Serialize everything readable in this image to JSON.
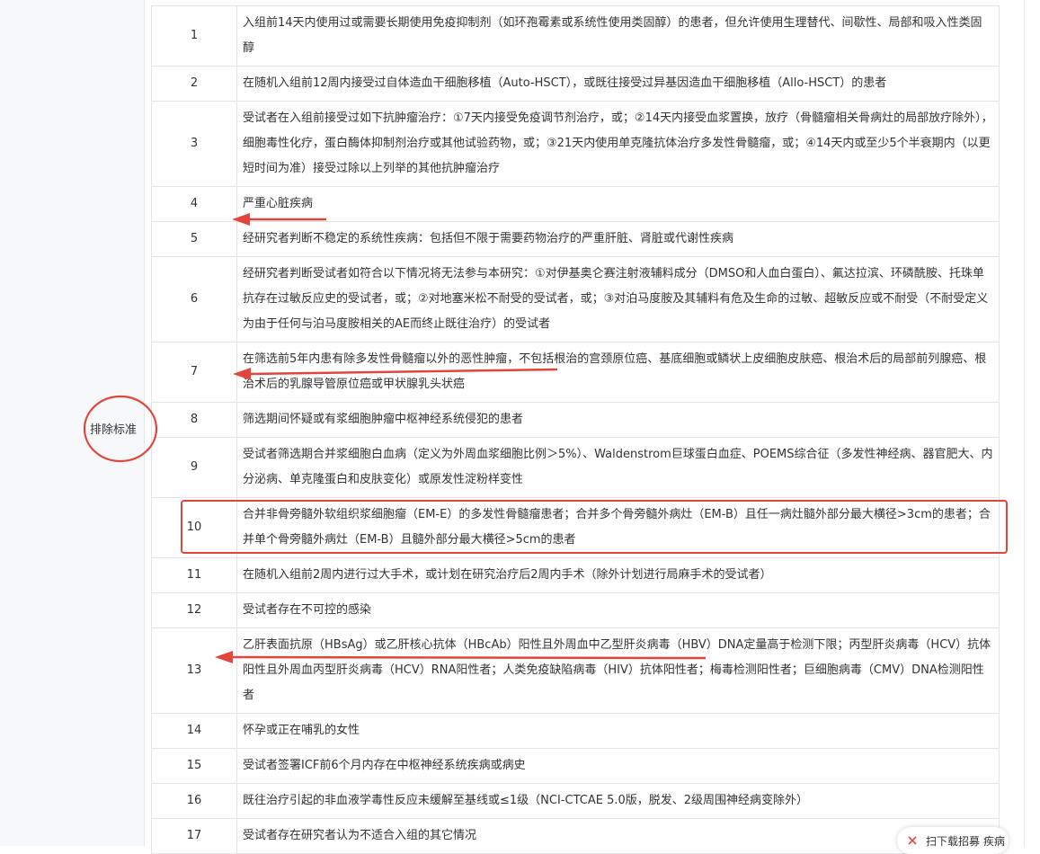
{
  "section_label": "排除标准",
  "annotation_color": "#e2453c",
  "rows": [
    {
      "num": "1",
      "text": "入组前14天内使用过或需要长期使用免疫抑制剂（如环孢霉素或系统性使用类固醇）的患者，但允许使用生理替代、间歇性、局部和吸入性类固醇"
    },
    {
      "num": "2",
      "text": "在随机入组前12周内接受过自体造血干细胞移植（Auto-HSCT），或既往接受过异基因造血干细胞移植（Allo-HSCT）的患者"
    },
    {
      "num": "3",
      "text": "受试者在入组前接受过如下抗肿瘤治疗：①7天内接受免疫调节剂治疗，或；②14天内接受血浆置换，放疗（骨髓瘤相关骨病灶的局部放疗除外），细胞毒性化疗，蛋白酶体抑制剂治疗或其他试验药物，或；③21天内使用单克隆抗体治疗多发性骨髓瘤，或；④14天内或至少5个半衰期内（以更短时间为准）接受过除以上列举的其他抗肿瘤治疗"
    },
    {
      "num": "4",
      "text": "严重心脏疾病"
    },
    {
      "num": "5",
      "text": "经研究者判断不稳定的系统性疾病：包括但不限于需要药物治疗的严重肝脏、肾脏或代谢性疾病"
    },
    {
      "num": "6",
      "text": "经研究者判断受试者如符合以下情况将无法参与本研究：①对伊基奥仑赛注射液辅料成分（DMSO和人血白蛋白）、氟达拉滨、环磷酰胺、托珠单抗存在过敏反应史的受试者，或；②对地塞米松不耐受的受试者，或；③对泊马度胺及其辅料有危及生命的过敏、超敏反应或不耐受（不耐受定义为由于任何与泊马度胺相关的AE而终止既往治疗）的受试者"
    },
    {
      "num": "7",
      "text": "在筛选前5年内患有除多发性骨髓瘤以外的恶性肿瘤，不包括根治的宫颈原位癌、基底细胞或鳞状上皮细胞皮肤癌、根治术后的局部前列腺癌、根治术后的乳腺导管原位癌或甲状腺乳头状癌"
    },
    {
      "num": "8",
      "text": "筛选期间怀疑或有浆细胞肿瘤中枢神经系统侵犯的患者"
    },
    {
      "num": "9",
      "text": "受试者筛选期合并浆细胞白血病（定义为外周血浆细胞比例＞5%）、Waldenstrom巨球蛋白血症、POEMS综合征（多发性神经病、器官肥大、内分泌病、单克隆蛋白和皮肤变化）或原发性淀粉样变性"
    },
    {
      "num": "10",
      "text": "合并非骨旁髓外软组织浆细胞瘤（EM-E）的多发性骨髓瘤患者；合并多个骨旁髓外病灶（EM-B）且任一病灶髓外部分最大横径>3cm的患者；合并单个骨旁髓外病灶（EM-B）且髓外部分最大横径>5cm的患者"
    },
    {
      "num": "11",
      "text": "在随机入组前2周内进行过大手术，或计划在研究治疗后2周内手术（除外计划进行局麻手术的受试者）"
    },
    {
      "num": "12",
      "text": "受试者存在不可控的感染"
    },
    {
      "num": "13",
      "text": "乙肝表面抗原（HBsAg）或乙肝核心抗体（HBcAb）阳性且外周血中乙型肝炎病毒（HBV）DNA定量高于检测下限；丙型肝炎病毒（HCV）抗体阳性且外周血丙型肝炎病毒（HCV）RNA阳性者；人类免疫缺陷病毒（HIV）抗体阳性者；梅毒检测阳性者；巨细胞病毒（CMV）DNA检测阳性者"
    },
    {
      "num": "14",
      "text": "怀孕或正在哺乳的女性"
    },
    {
      "num": "15",
      "text": "受试者签署ICF前6个月内存在中枢神经系统疾病或病史"
    },
    {
      "num": "16",
      "text": "既往治疗引起的非血液学毒性反应未缓解至基线或≤1级（NCI-CTCAE 5.0版，脱发、2级周围神经病变除外）"
    },
    {
      "num": "17",
      "text": "受试者存在研究者认为不适合入组的其它情况"
    }
  ],
  "floating_button": {
    "label": "扫下载招募 疾病"
  }
}
